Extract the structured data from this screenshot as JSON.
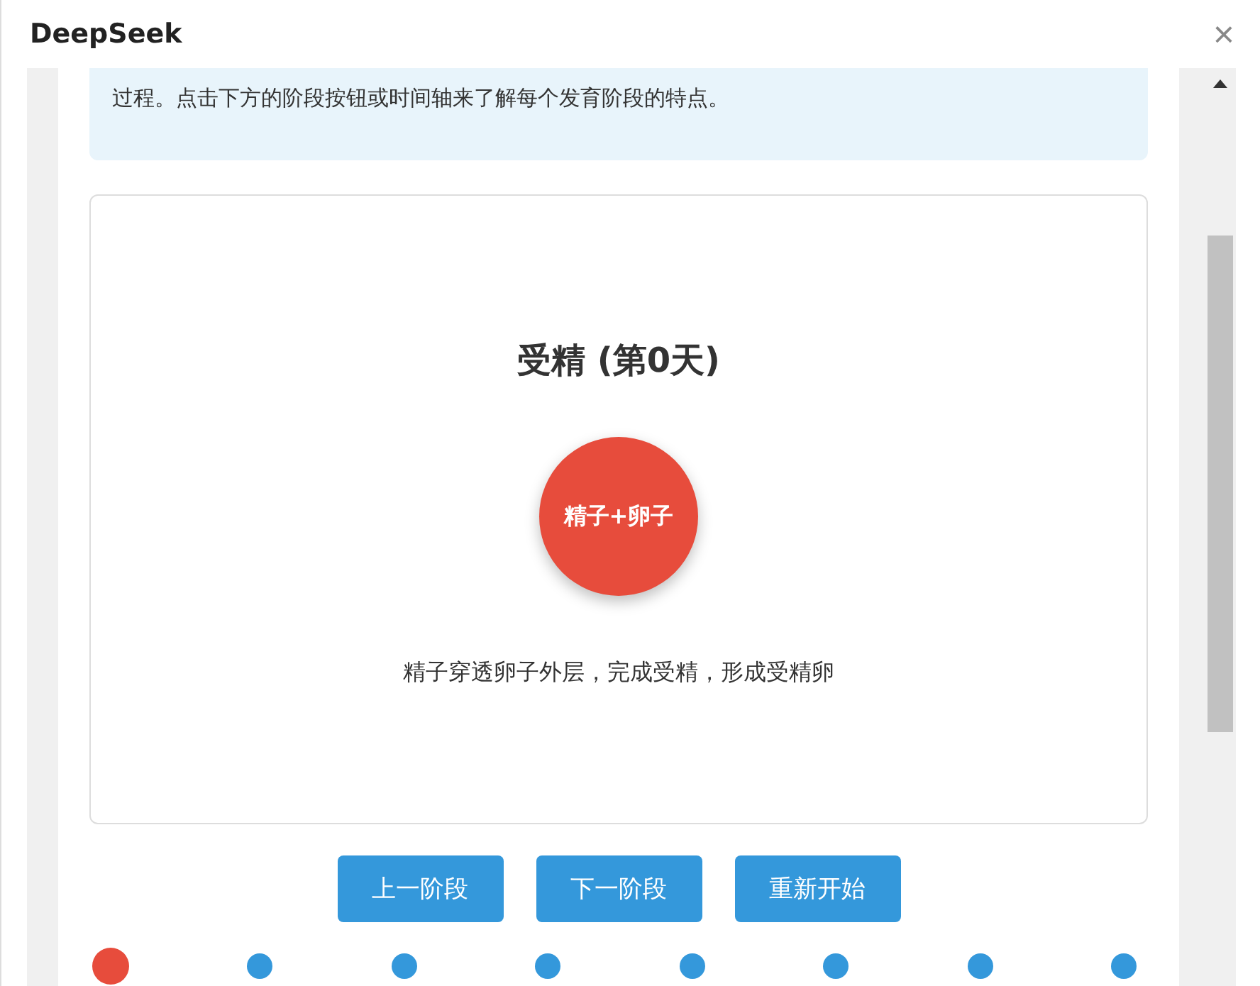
{
  "window": {
    "title": "DeepSeek",
    "close": "×"
  },
  "intro": {
    "text": "过程。点击下方的阶段按钮或时间轴来了解每个发育阶段的特点。"
  },
  "stage": {
    "title": "受精 (第0天)",
    "circle_label": "精子+卵子",
    "description": "精子穿透卵子外层，完成受精，形成受精卵"
  },
  "buttons": [
    "上一阶段",
    "下一阶段",
    "重新开始"
  ],
  "timeline": [
    {
      "selected": true
    },
    {
      "selected": false
    },
    {
      "selected": false
    },
    {
      "selected": false
    },
    {
      "selected": false
    },
    {
      "selected": false
    },
    {
      "selected": false
    },
    {
      "selected": false
    }
  ]
}
